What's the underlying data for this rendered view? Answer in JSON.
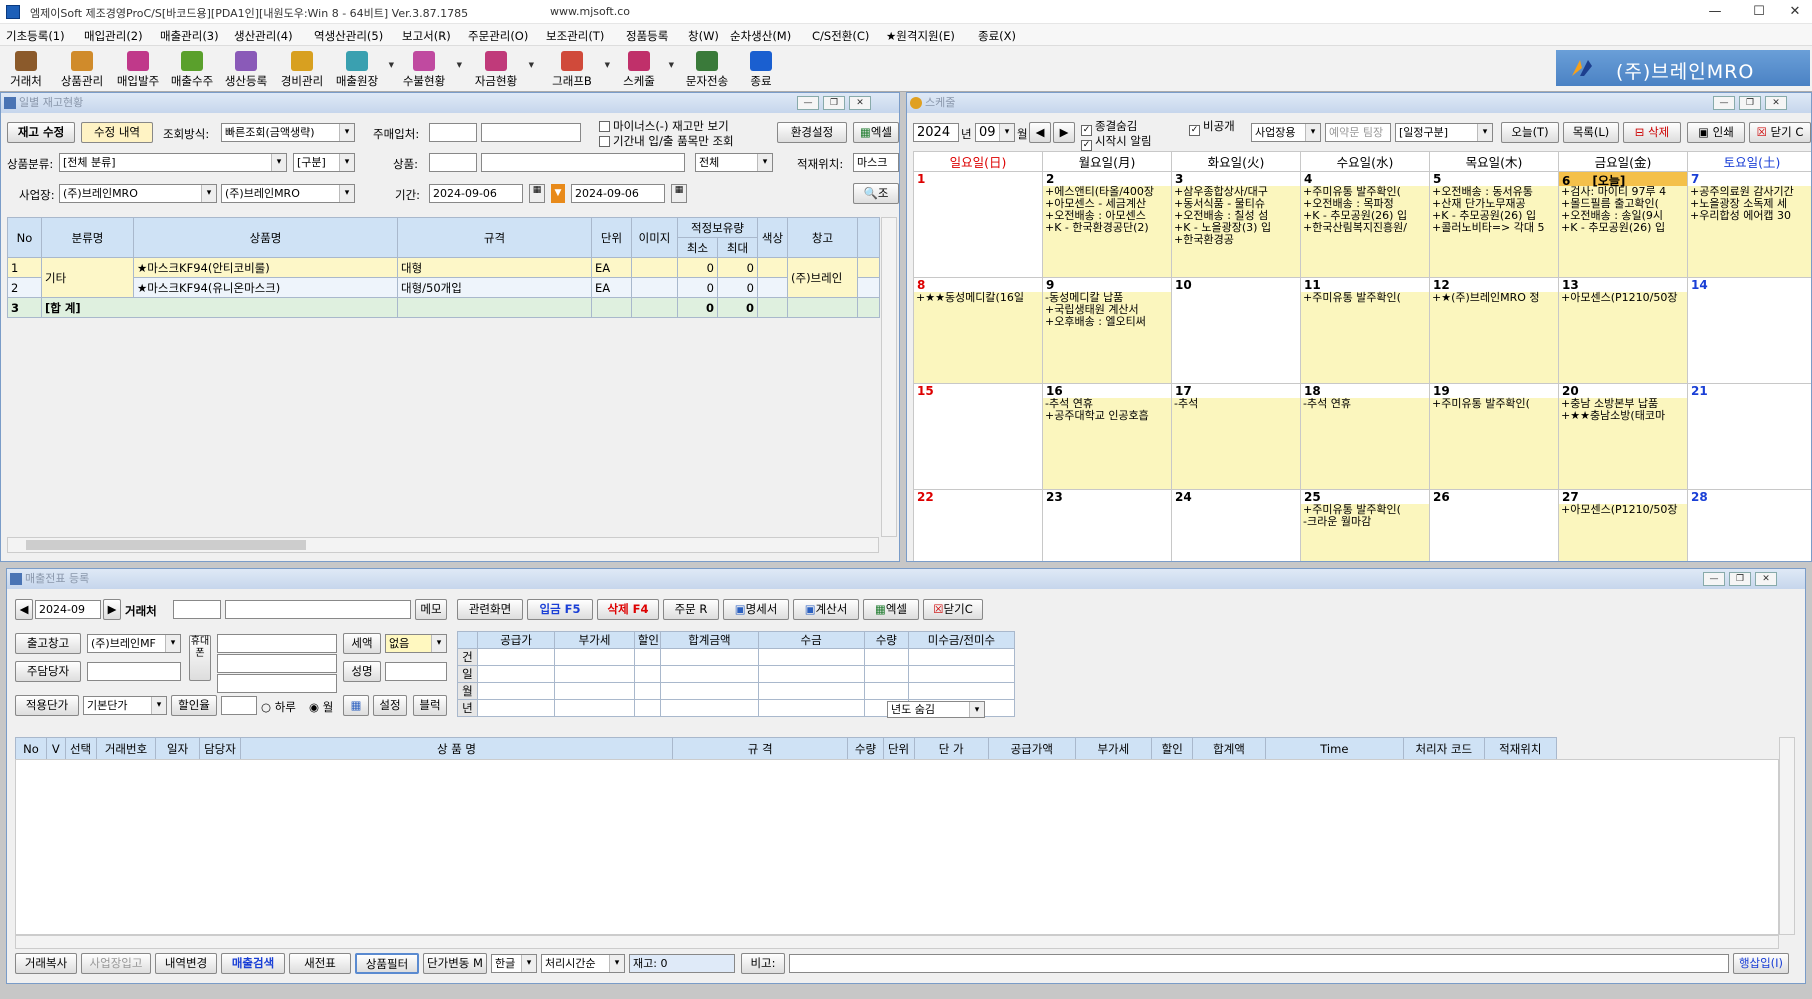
{
  "app": {
    "title": "엠제이Soft 제조경영ProC/S[바코드용][PDA1인][내원도우:Win 8 - 64비트] Ver.3.87.1785",
    "url": "www.mjsoft.co"
  },
  "menu": [
    "기초등록(1)",
    "매입관리(2)",
    "매출관리(3)",
    "생산관리(4)",
    "역생산관리(5)",
    "보고서(R)",
    "주문관리(O)",
    "보조관리(T)",
    "정품등록",
    "창(W)",
    "순차생산(M)",
    "C/S전환(C)",
    "★원격지원(E)",
    "종료(X)"
  ],
  "toolbar": [
    {
      "label": "거래처",
      "icon": "handshake-icon",
      "color": "#8b5a2b"
    },
    {
      "label": "상품관리",
      "icon": "box-icon",
      "color": "#d08b2b"
    },
    {
      "label": "매입발주",
      "icon": "purchase-icon",
      "color": "#c0398a"
    },
    {
      "label": "매출수주",
      "icon": "sales-icon",
      "color": "#5aa02c"
    },
    {
      "label": "생산등록",
      "icon": "production-icon",
      "color": "#8a5ab8"
    },
    {
      "label": "경비관리",
      "icon": "expense-icon",
      "color": "#d8a020"
    },
    {
      "label": "매출원장",
      "icon": "ledger-icon",
      "color": "#3aa0b0"
    },
    {
      "label": "수불현황",
      "icon": "inventory-icon",
      "color": "#c04aa0"
    },
    {
      "label": "자금현황",
      "icon": "fund-icon",
      "color": "#c03a7a"
    },
    {
      "label": "그래프B",
      "icon": "graph-icon",
      "color": "#d04a3a"
    },
    {
      "label": "스케줄",
      "icon": "schedule-icon",
      "color": "#c0306a"
    },
    {
      "label": "문자전송",
      "icon": "sms-icon",
      "color": "#3a7a3a"
    },
    {
      "label": "종료",
      "icon": "close-icon",
      "color": "#1a5fd0"
    }
  ],
  "brand": {
    "name": "(주)브레인MRO"
  },
  "inventory": {
    "title": "일별 재고현황",
    "btn_edit": "재고 수정",
    "btn_history": "수정 내역",
    "lookup_label": "조회방식:",
    "lookup_value": "빠른조회(금액생략)",
    "buyer_label": "주매입처:",
    "minus_only": "마이너스(-) 재고만 보기",
    "period_only": "기간내 입/출 품목만 조회",
    "btn_settings": "환경설정",
    "btn_excel": "엑셀",
    "category_label": "상품분류:",
    "category_value": "[전체 분류]",
    "kind_value": "[구분]",
    "product_label": "상품:",
    "all_value": "전체",
    "location_label": "적재위치:",
    "location_value": "마스크",
    "site_label": "사업장:",
    "site_value1": "(주)브레인MRO",
    "site_value2": "(주)브레인MRO",
    "period_label": "기간:",
    "date_from": "2024-09-06",
    "date_to": "2024-09-06",
    "btn_search": "조",
    "cols": [
      "No",
      "분류명",
      "상품명",
      "규격",
      "단위",
      "이미지",
      "적정보유량",
      "색상",
      "창고"
    ],
    "sub_cols": [
      "최소",
      "최대"
    ],
    "rows": [
      {
        "no": "1",
        "cat": "기타",
        "name": "★마스크KF94(안티코비룰)",
        "spec": "대형",
        "unit": "EA",
        "min": "0",
        "max": "0",
        "wh": "(주)브레인"
      },
      {
        "no": "2",
        "cat": "",
        "name": "★마스크KF94(유니온마스크)",
        "spec": "대형/50개입",
        "unit": "EA",
        "min": "0",
        "max": "0",
        "wh": ""
      }
    ],
    "total": {
      "no": "3",
      "label": "[합 계]",
      "min": "0",
      "max": "0"
    }
  },
  "schedule": {
    "title": "스케줄",
    "year": "2024",
    "year_suffix": "년",
    "month": "09",
    "month_suffix": "월",
    "chk_weekend": "종결숨김",
    "chk_start_alarm": "시작시 알림",
    "chk_private": "비공개",
    "category": "사업장용",
    "reserve": "예약문 팀장",
    "type": "[일정구분]",
    "btn_today": "오늘(T)",
    "btn_list": "목록(L)",
    "btn_delete": "삭제",
    "btn_print": "인쇄",
    "btn_close": "닫기 C",
    "days": [
      "일요일(日)",
      "월요일(月)",
      "화요일(火)",
      "수요일(水)",
      "목요일(木)",
      "금요일(金)",
      "토요일(土)"
    ],
    "today_label": "[오늘]",
    "weeks": [
      [
        {
          "d": "1",
          "ev": [],
          "y": false
        },
        {
          "d": "2",
          "ev": [
            "+에스앤티(타올/400장",
            "+아모센스 - 세금계산",
            "+오전배송 : 아모센스",
            "+K - 한국환경공단(2)"
          ],
          "y": true
        },
        {
          "d": "3",
          "ev": [
            "+삼우종합상사/대구",
            "+동서식품 - 물티슈",
            "+오전배송 : 칠성 섬",
            "+K - 노을광장(3) 입",
            "+한국환경공"
          ],
          "y": true
        },
        {
          "d": "4",
          "ev": [
            "+주미유통 발주확인(",
            "+오전배송 : 목파정",
            "+K - 추모공원(26) 입",
            "+한국산림복지진흥원/"
          ],
          "y": true
        },
        {
          "d": "5",
          "ev": [
            "+오전배송 : 동서유통",
            "+산재 단가노무재공",
            "+K - 추모공원(26) 입",
            "+콜러노비타=> 각대 5"
          ],
          "y": true
        },
        {
          "d": "6",
          "ev": [
            "+검사: 마이티 97루 4",
            "+몰드필름 출고확인(",
            "+오전배송 : 송일(9시",
            "+K - 추모공원(26) 입"
          ],
          "y": true,
          "today": true
        },
        {
          "d": "7",
          "ev": [
            "+공주의료원 감사기간",
            "+노을광장 소독제 세",
            "+우리합성 에어캡 30"
          ],
          "y": true
        }
      ],
      [
        {
          "d": "8",
          "ev": [
            "+★★동성메디칼(16일"
          ],
          "y": true
        },
        {
          "d": "9",
          "ev": [
            "-동성메디칼 납품",
            "+국립생태원 계산서",
            "+오후배송 : 엘오티써"
          ],
          "y": true
        },
        {
          "d": "10",
          "ev": [],
          "y": false
        },
        {
          "d": "11",
          "ev": [
            "+주미유통 발주확인("
          ],
          "y": true
        },
        {
          "d": "12",
          "ev": [
            "+★(주)브레인MRO 정"
          ],
          "y": true
        },
        {
          "d": "13",
          "ev": [
            "+아모센스(P1210/50장"
          ],
          "y": true
        },
        {
          "d": "14",
          "ev": [],
          "y": false
        }
      ],
      [
        {
          "d": "15",
          "ev": [],
          "y": false
        },
        {
          "d": "16",
          "ev": [
            "-추석 연휴",
            "+공주대학교 인공호흡"
          ],
          "y": true
        },
        {
          "d": "17",
          "ev": [
            "-추석"
          ],
          "y": true
        },
        {
          "d": "18",
          "ev": [
            "-추석 연휴"
          ],
          "y": true
        },
        {
          "d": "19",
          "ev": [
            "+주미유통 발주확인("
          ],
          "y": true
        },
        {
          "d": "20",
          "ev": [
            "+충남 소방본부 납품",
            "+★★충남소방(태코마"
          ],
          "y": true
        },
        {
          "d": "21",
          "ev": [],
          "y": false
        }
      ],
      [
        {
          "d": "22",
          "ev": [],
          "y": false
        },
        {
          "d": "23",
          "ev": [],
          "y": false
        },
        {
          "d": "24",
          "ev": [],
          "y": false
        },
        {
          "d": "25",
          "ev": [
            "+주미유통 발주확인(",
            "-크라운 월마감"
          ],
          "y": true
        },
        {
          "d": "26",
          "ev": [],
          "y": false
        },
        {
          "d": "27",
          "ev": [
            "+아모센스(P1210/50장"
          ],
          "y": true
        },
        {
          "d": "28",
          "ev": [],
          "y": false
        }
      ]
    ]
  },
  "sales": {
    "title": "매출전표 등록",
    "month": "2024-09",
    "client_label": "거래처",
    "btn_memo": "메모",
    "btn_related": "관련화면",
    "btn_deposit": "입금 F5",
    "btn_delete": "삭제 F4",
    "btn_order": "주문 R",
    "btn_statement": "명세서",
    "btn_invoice": "계산서",
    "btn_excel": "엑셀",
    "btn_close": "닫기C",
    "warehouse_label": "출고창고",
    "warehouse_value": "(주)브레인MF",
    "manager_label": "주담당자",
    "tax_label": "세액",
    "tax_value": "없음",
    "name_label": "성명",
    "phone_label": "휴대폰",
    "price_label": "적용단가",
    "price_value": "기본단가",
    "discount_label": "할인율",
    "radio_day": "하루",
    "radio_month": "월",
    "btn_setting": "설정",
    "btn_block": "블럭",
    "summary_cols": [
      "공급가",
      "부가세",
      "할인",
      "합계금액",
      "수금",
      "수량",
      "미수금/전미수"
    ],
    "summary_rows": [
      "건",
      "일",
      "월",
      "년"
    ],
    "year_hide": "년도 숨김",
    "cols": [
      "No",
      "V",
      "선택",
      "거래번호",
      "일자",
      "담당자",
      "상 품 명",
      "규 격",
      "수량",
      "단위",
      "단 가",
      "공급가액",
      "부가세",
      "할인",
      "합계액",
      "Time",
      "처리자 코드",
      "적재위치"
    ],
    "footer": {
      "copy": "거래복사",
      "site_in": "사업장입고",
      "history": "내역변경",
      "search": "매출검색",
      "new": "새전표",
      "filter": "상품필터",
      "price_change": "단가변동 M",
      "lang": "한글",
      "sort": "처리시간순",
      "stock": "재고: 0",
      "note_label": "비고:",
      "btn_add": "행삽입(I)"
    }
  }
}
